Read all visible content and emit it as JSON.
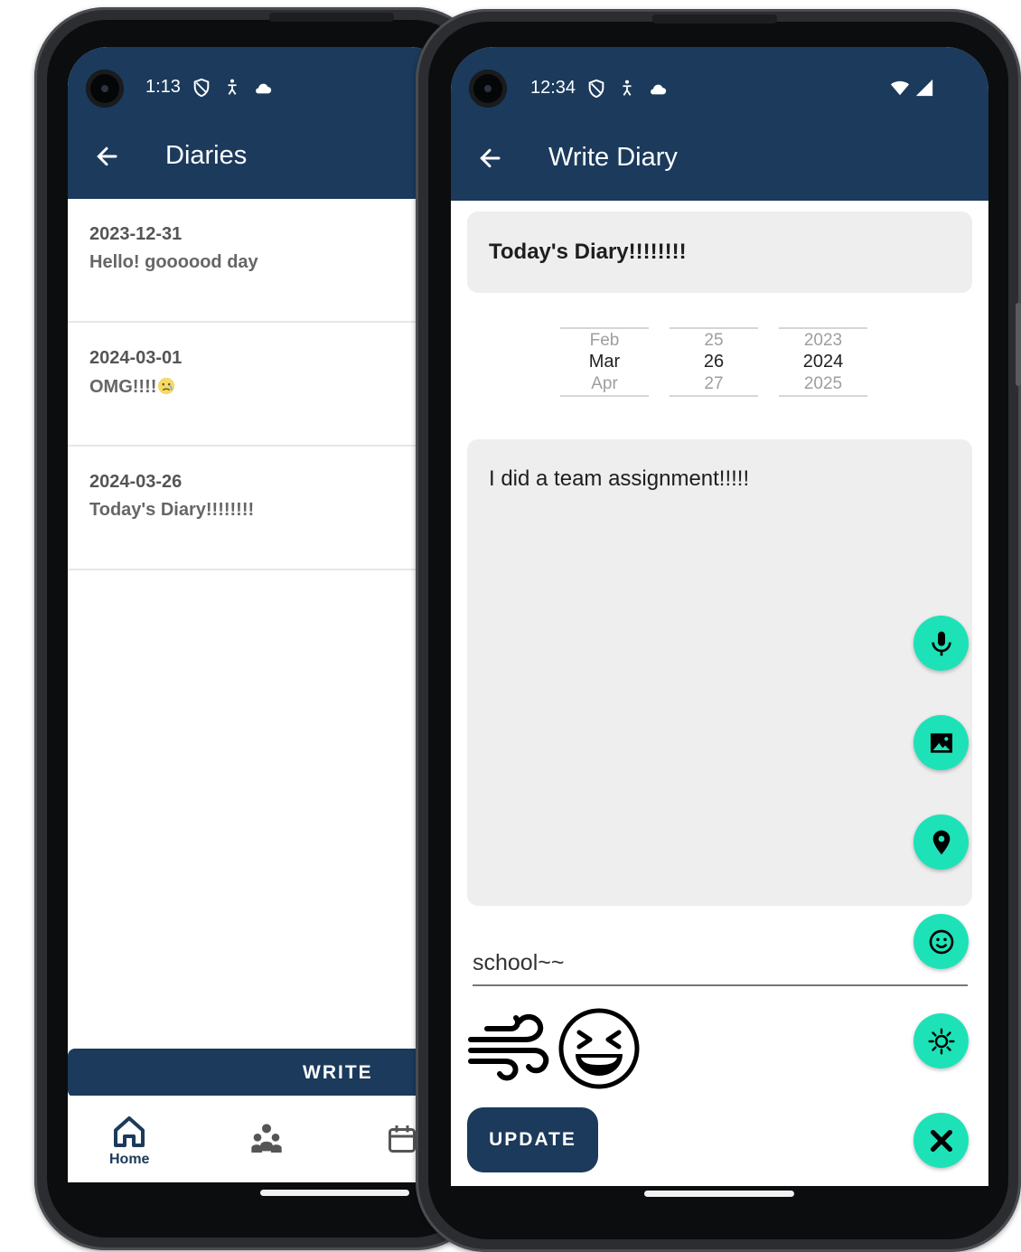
{
  "colors": {
    "primary": "#1b3a5c",
    "fab": "#1de2b8",
    "field_bg": "#eeeeee"
  },
  "diaries_screen": {
    "status_time": "1:13",
    "title": "Diaries",
    "items": [
      {
        "date": "2023-12-31",
        "text": "Hello! goooood day"
      },
      {
        "date": "2024-03-01",
        "text": "OMG!!!!",
        "emoji": "crying-face-icon"
      },
      {
        "date": "2024-03-26",
        "text": "Today's Diary!!!!!!!!"
      }
    ],
    "write_label": "WRITE",
    "nav": {
      "home_label": "Home"
    }
  },
  "write_screen": {
    "status_time": "12:34",
    "title": "Write Diary",
    "diary_title": "Today's Diary!!!!!!!!",
    "date_picker": {
      "month": {
        "prev": "Feb",
        "selected": "Mar",
        "next": "Apr"
      },
      "day": {
        "prev": "25",
        "selected": "26",
        "next": "27"
      },
      "year": {
        "prev": "2023",
        "selected": "2024",
        "next": "2025"
      }
    },
    "content": "I did a team assignment!!!!!",
    "tag": "school~~",
    "weather_icon": "wind-icon",
    "mood_icon": "laughing-face-icon",
    "update_label": "UPDATE",
    "fab_icons": [
      "microphone-icon",
      "image-icon",
      "location-pin-icon",
      "smiley-icon",
      "sun-icon",
      "close-icon"
    ]
  }
}
